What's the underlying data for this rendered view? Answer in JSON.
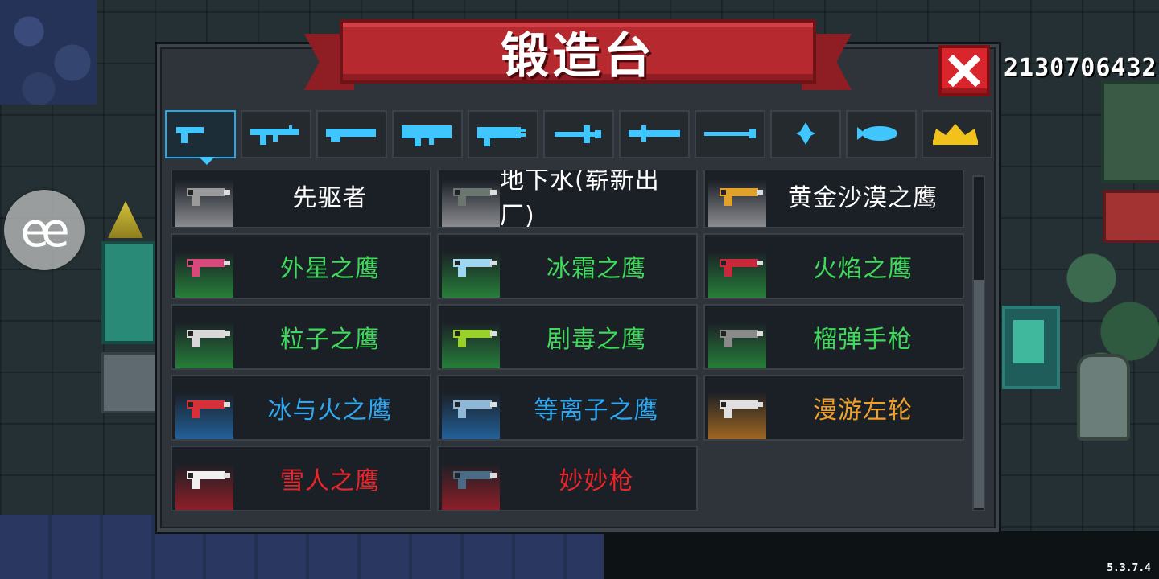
{
  "title": "锻造台",
  "coins": "2130706432",
  "version": "5.3.7.4",
  "float_button": "ee",
  "colors": {
    "white": "#ffffff",
    "green": "#3fd95b",
    "blue": "#2fa8f2",
    "orange": "#f0a02a",
    "red": "#e8262c",
    "tab_icon": "#3fc6ff",
    "tab_star": "#f2c21c"
  },
  "tabs": [
    {
      "icon": "pistol-icon",
      "active": true
    },
    {
      "icon": "rifle-icon"
    },
    {
      "icon": "shotgun-icon"
    },
    {
      "icon": "launcher-icon"
    },
    {
      "icon": "laser-gun-icon"
    },
    {
      "icon": "bow-icon"
    },
    {
      "icon": "sword-icon"
    },
    {
      "icon": "spear-icon"
    },
    {
      "icon": "shuriken-icon"
    },
    {
      "icon": "fish-icon"
    },
    {
      "icon": "crown-icon"
    }
  ],
  "weapons": [
    {
      "name": "先驱者",
      "rarity": "white",
      "icon": "pistol-gray-icon"
    },
    {
      "name": "地下水(崭新出厂)",
      "rarity": "white",
      "icon": "smg-icon"
    },
    {
      "name": "黄金沙漠之鹰",
      "rarity": "white",
      "icon": "golden-pistol-icon"
    },
    {
      "name": "外星之鹰",
      "rarity": "green",
      "icon": "alien-pistol-icon"
    },
    {
      "name": "冰霜之鹰",
      "rarity": "green",
      "icon": "frost-pistol-icon"
    },
    {
      "name": "火焰之鹰",
      "rarity": "green",
      "icon": "fire-pistol-icon"
    },
    {
      "name": "粒子之鹰",
      "rarity": "green",
      "icon": "particle-pistol-icon"
    },
    {
      "name": "剧毒之鹰",
      "rarity": "green",
      "icon": "poison-pistol-icon"
    },
    {
      "name": "榴弹手枪",
      "rarity": "green",
      "icon": "grenade-pistol-icon"
    },
    {
      "name": "冰与火之鹰",
      "rarity": "blue",
      "icon": "ice-fire-pistol-icon"
    },
    {
      "name": "等离子之鹰",
      "rarity": "blue",
      "icon": "plasma-pistol-icon"
    },
    {
      "name": "漫游左轮",
      "rarity": "orange",
      "icon": "revolver-icon"
    },
    {
      "name": "雪人之鹰",
      "rarity": "red",
      "icon": "snowman-pistol-icon"
    },
    {
      "name": "妙妙枪",
      "rarity": "red",
      "icon": "cat-gun-icon"
    }
  ]
}
